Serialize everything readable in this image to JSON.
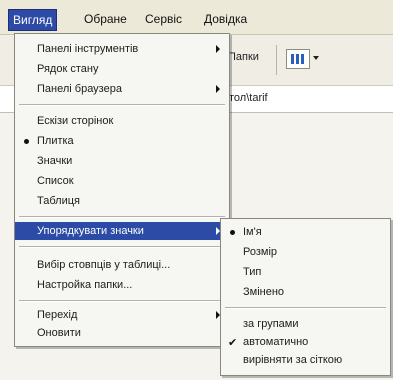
{
  "menubar": {
    "items": [
      {
        "label": "Вигляд",
        "active": true
      },
      {
        "label": "Обране"
      },
      {
        "label": "Сервіс"
      },
      {
        "label": "Довідка"
      }
    ]
  },
  "toolbar": {
    "folders_label": "Папки"
  },
  "address": {
    "text": "тол\\tarif"
  },
  "view_menu": {
    "items": [
      {
        "label": "Панелі інструментів",
        "submenu": true
      },
      {
        "label": "Рядок стану"
      },
      {
        "label": "Панелі браузера",
        "submenu": true
      },
      {
        "label": "Ескізи сторінок"
      },
      {
        "label": "Плитка",
        "selected": true
      },
      {
        "label": "Значки"
      },
      {
        "label": "Список"
      },
      {
        "label": "Таблиця"
      },
      {
        "label": "Упорядкувати значки",
        "submenu": true,
        "highlighted": true
      },
      {
        "label": "Вибір стовпців у таблиці..."
      },
      {
        "label": "Настройка папки..."
      },
      {
        "label": "Перехід",
        "submenu": true
      },
      {
        "label": "Оновити"
      }
    ]
  },
  "arrange_submenu": {
    "items": [
      {
        "label": "Ім'я",
        "selected": true
      },
      {
        "label": "Розмір"
      },
      {
        "label": "Тип"
      },
      {
        "label": "Змінено"
      },
      {
        "label": "за групами"
      },
      {
        "label": "автоматично",
        "checked": true
      },
      {
        "label": "вирівняти за сіткою"
      }
    ]
  },
  "colors": {
    "highlight": "#2b4ba6",
    "menu_bg": "#f6f6f3",
    "menubar_bg": "#ece9d8"
  }
}
